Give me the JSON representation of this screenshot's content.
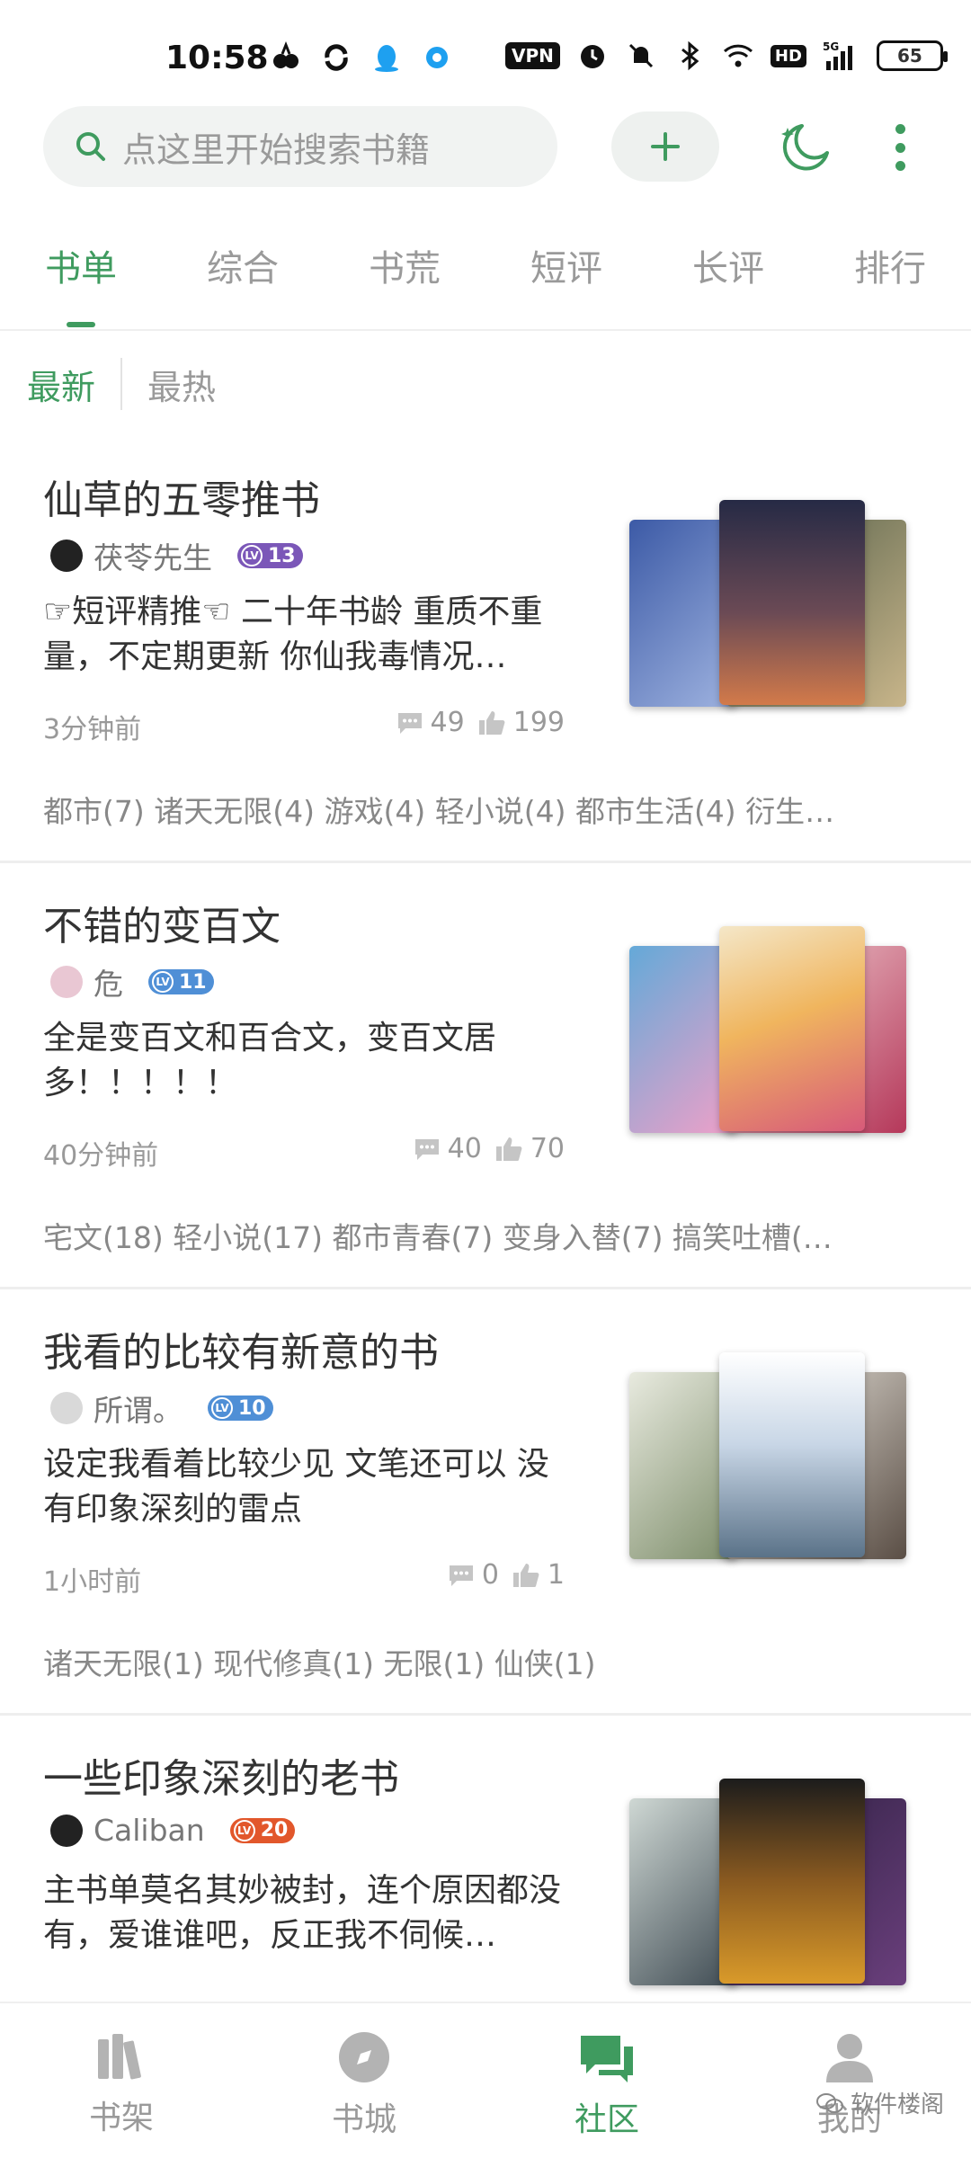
{
  "status_bar": {
    "time": "10:58",
    "vpn": "VPN",
    "hd": "HD",
    "network": "5G",
    "battery": "65"
  },
  "header": {
    "search_placeholder": "点这里开始搜索书籍",
    "add_icon": "plus-icon",
    "night_icon": "moon-icon",
    "more_icon": "more-vertical-icon",
    "accent_color": "#3f9b5f"
  },
  "tabs": [
    {
      "label": "书单",
      "active": true
    },
    {
      "label": "综合"
    },
    {
      "label": "书荒"
    },
    {
      "label": "短评"
    },
    {
      "label": "长评"
    },
    {
      "label": "排行"
    }
  ],
  "sort": {
    "latest": "最新",
    "hot": "最热"
  },
  "booklists": [
    {
      "title": "仙草的五零推书",
      "author": "茯苓先生",
      "level": "13",
      "level_color": "#7b57b8",
      "desc": "☞短评精推☜ 二十年书龄 重质不重量，不定期更新 你仙我毒情况…",
      "time": "3分钟前",
      "comments": "49",
      "likes": "199",
      "tags": "都市(7) 诸天无限(4) 游戏(4) 轻小说(4) 都市生活(4) 衍生…"
    },
    {
      "title": "不错的变百文",
      "author": "危",
      "level": "11",
      "level_color": "#4f8fd6",
      "desc": "全是变百文和百合文，变百文居多！！！！！",
      "time": "40分钟前",
      "comments": "40",
      "likes": "70",
      "tags": "宅文(18) 轻小说(17) 都市青春(7) 变身入替(7) 搞笑吐槽(…"
    },
    {
      "title": "我看的比较有新意的书",
      "author": "所谓。",
      "level": "10",
      "level_color": "#4f8fd6",
      "desc": "设定我看着比较少见 文笔还可以 没有印象深刻的雷点",
      "time": "1小时前",
      "comments": "0",
      "likes": "1",
      "tags": "诸天无限(1) 现代修真(1) 无限(1) 仙侠(1)"
    },
    {
      "title": "一些印象深刻的老书",
      "author": "Caliban",
      "level": "20",
      "level_color": "#e2572b",
      "desc": "主书单莫名其妙被封，连个原因都没有，爱谁谁吧，反正我不伺候…",
      "time": "",
      "comments": "",
      "likes": "",
      "tags": ""
    }
  ],
  "bottom_nav": [
    {
      "label": "书架",
      "icon": "bookshelf-icon"
    },
    {
      "label": "书城",
      "icon": "compass-icon"
    },
    {
      "label": "社区",
      "icon": "chat-bubbles-icon",
      "active": true
    },
    {
      "label": "我的",
      "icon": "person-icon"
    }
  ],
  "watermark": "软件楼阁"
}
